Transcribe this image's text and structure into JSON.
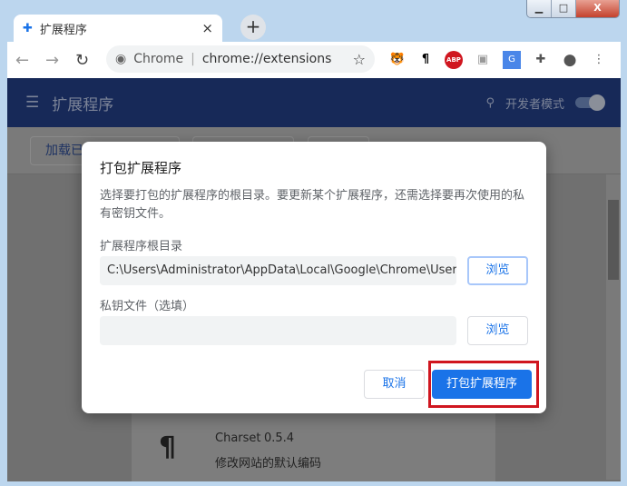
{
  "tab": {
    "title": "扩展程序",
    "close": "×"
  },
  "new_tab": "+",
  "window_buttons": {
    "minimize": "▁",
    "maximize": "□",
    "close": "X"
  },
  "omnibox": {
    "site": "Chrome",
    "url": "chrome://extensions"
  },
  "extensions": [
    "extension-1",
    "charset",
    "adblock-plus",
    "extension-4",
    "google-translate",
    "extensions-menu",
    "profile",
    "menu"
  ],
  "header": {
    "title": "扩展程序",
    "dev_mode": "开发者模式",
    "dev_mode_on": true
  },
  "subbar": {
    "load_unpacked": "加载已"
  },
  "dialog": {
    "title": "打包扩展程序",
    "description": "选择要打包的扩展程序的根目录。要更新某个扩展程序，还需选择要再次使用的私有密钥文件。",
    "root_label": "扩展程序根目录",
    "root_value": "C:\\Users\\Administrator\\AppData\\Local\\Google\\Chrome\\User D...",
    "key_label": "私钥文件（选填）",
    "key_value": "",
    "browse": "浏览",
    "cancel": "取消",
    "pack": "打包扩展程序"
  },
  "card": {
    "name": "Charset",
    "version": "0.5.4",
    "description": "修改网站的默认编码"
  },
  "colors": {
    "accent": "#1a73e8",
    "highlight": "#d0161f",
    "header": "#172958"
  }
}
